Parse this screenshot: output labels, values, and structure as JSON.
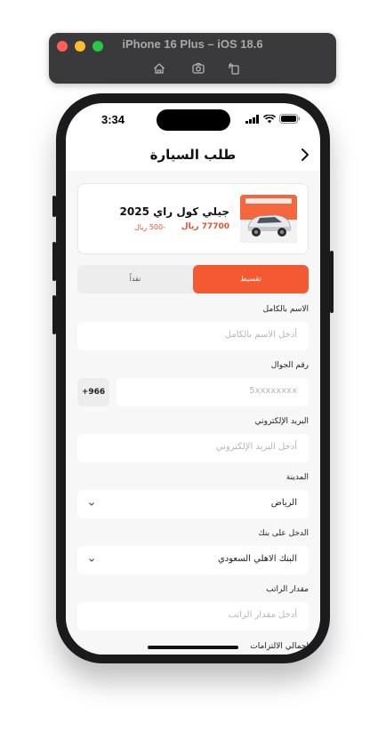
{
  "simulator": {
    "title": "iPhone 16 Plus – iOS 18.6",
    "tools": [
      "home-icon",
      "screenshot-icon",
      "rotate-icon"
    ]
  },
  "status_bar": {
    "time": "3:34"
  },
  "nav": {
    "title": "طلب السيارة"
  },
  "car": {
    "name": "جيلي كول راي 2025",
    "price": "77700 ريال",
    "down_payment": "-500 ريال"
  },
  "payment_tabs": {
    "active": "تقسيط",
    "inactive": "نقداً"
  },
  "form": {
    "full_name": {
      "label": "الاسم بالكامل",
      "placeholder": "أدخل الاسم بالكامل"
    },
    "mobile": {
      "label": "رقم الجوال",
      "placeholder": "5xxxxxxxx",
      "country_code": "+966"
    },
    "email": {
      "label": "البريد الإلكتروني",
      "placeholder": "أدخل البريد الإلكتروني"
    },
    "city": {
      "label": "المدينة",
      "value": "الرياض"
    },
    "bank": {
      "label": "الدخل على بنك",
      "value": "البنك الاهلي السعودي"
    },
    "salary": {
      "label": "مقدار الراتب",
      "placeholder": "أدخل مقدار الراتب"
    },
    "obligations": {
      "label": "اجمالي الالتزامات"
    }
  },
  "colors": {
    "accent": "#f35a32",
    "price": "#e4522f"
  }
}
